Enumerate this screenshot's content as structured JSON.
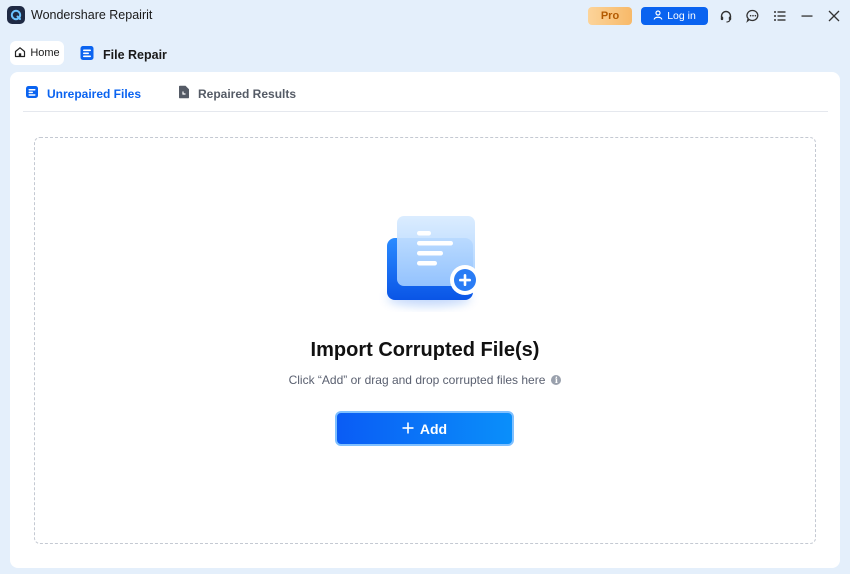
{
  "app": {
    "title": "Wondershare Repairit",
    "pro_label": "Pro",
    "login_label": "Log in"
  },
  "nav": {
    "home_label": "Home",
    "section_label": "File Repair"
  },
  "tabs": [
    {
      "label": "Unrepaired Files",
      "active": true
    },
    {
      "label": "Repaired Results",
      "active": false
    }
  ],
  "dropzone": {
    "title": "Import Corrupted File(s)",
    "subtitle": "Click “Add” or drag and drop corrupted files here",
    "add_label": "Add"
  },
  "colors": {
    "accent": "#0a63f0",
    "background": "#e4effb",
    "pro_badge": "#f7b969"
  },
  "icons": [
    "app-logo-icon",
    "user-icon",
    "headset-icon",
    "chat-icon",
    "menu-icon",
    "minimize-icon",
    "close-icon",
    "home-icon",
    "file-repair-icon",
    "document-list-icon",
    "document-icon",
    "info-icon",
    "plus-icon"
  ]
}
